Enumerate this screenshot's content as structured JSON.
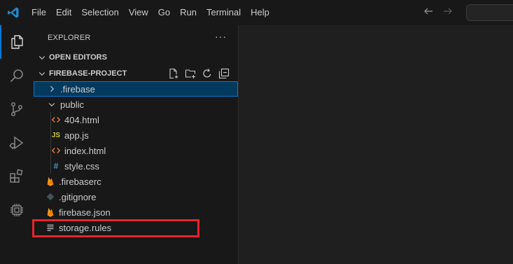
{
  "menu": [
    "File",
    "Edit",
    "Selection",
    "View",
    "Go",
    "Run",
    "Terminal",
    "Help"
  ],
  "explorer": {
    "title": "EXPLORER",
    "more": "···",
    "open_editors": "OPEN EDITORS",
    "project": "FIREBASE-PROJECT"
  },
  "tree": [
    {
      "label": ".firebase",
      "icon": "chevron-right-icon",
      "selected": true
    },
    {
      "label": "public",
      "icon": "chevron-down-icon"
    },
    {
      "label": "404.html",
      "icon": "html-icon",
      "color": "#e37933"
    },
    {
      "label": "app.js",
      "icon": "js-icon",
      "icon_text": "JS",
      "color": "#cbcb41"
    },
    {
      "label": "index.html",
      "icon": "html-icon",
      "color": "#e37933"
    },
    {
      "label": "style.css",
      "icon": "css-icon",
      "icon_text": "#",
      "color": "#519aba"
    },
    {
      "label": ".firebaserc",
      "icon": "firebase-icon",
      "color": "#f5a623"
    },
    {
      "label": ".gitignore",
      "icon": "git-icon",
      "color": "#41535b"
    },
    {
      "label": "firebase.json",
      "icon": "firebase-icon",
      "color": "#f5a623"
    },
    {
      "label": "storage.rules",
      "icon": "text-file-icon",
      "color": "#cccccc"
    }
  ],
  "colors": {
    "accent": "#0078d4",
    "highlight": "#e8242a",
    "vscode_blue": "#2489ca"
  }
}
